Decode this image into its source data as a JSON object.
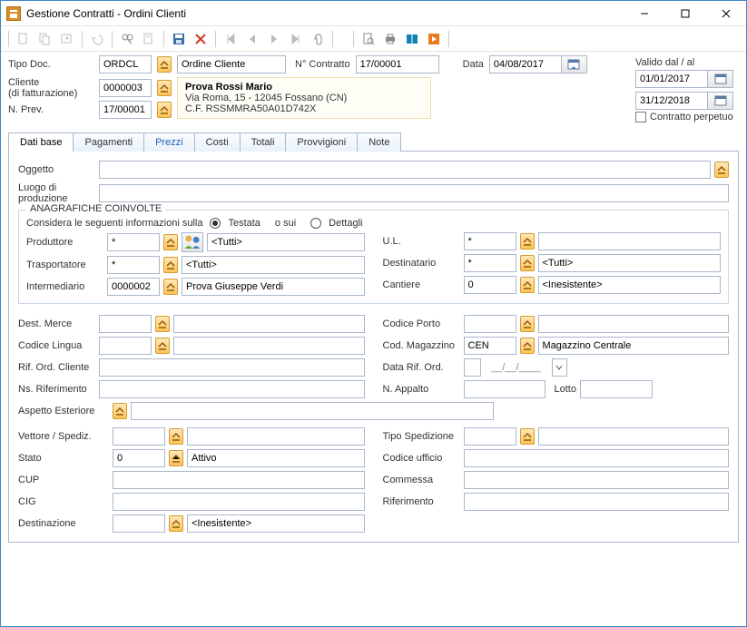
{
  "window": {
    "title": "Gestione Contratti - Ordini Clienti"
  },
  "header": {
    "tipo_doc_label": "Tipo Doc.",
    "tipo_doc_value": "ORDCL",
    "tipo_doc_desc": "Ordine Cliente",
    "n_contratto_label": "N° Contratto",
    "n_contratto_value": "17/00001",
    "data_label": "Data",
    "data_value": "04/08/2017",
    "cliente_label1": "Cliente",
    "cliente_label2": "(di fatturazione)",
    "cliente_value": "0000003",
    "nprev_label": "N. Prev.",
    "nprev_value": "17/00001",
    "addr_name": "Prova Rossi Mario",
    "addr_line1": "Via Roma, 15 - 12045 Fossano (CN)",
    "addr_line2": "C.F. RSSMMRA50A01D742X"
  },
  "validity": {
    "title": "Valido dal / al",
    "from": "01/01/2017",
    "to": "31/12/2018",
    "perpetuo_label": "Contratto perpetuo"
  },
  "tabs": {
    "t0": "Dati base",
    "t1": "Pagamenti",
    "t2": "Prezzi",
    "t3": "Costi",
    "t4": "Totali",
    "t5": "Provvigioni",
    "t6": "Note"
  },
  "base": {
    "oggetto_label": "Oggetto",
    "luogo_label1": "Luogo di",
    "luogo_label2": "produzione",
    "anag_title": "ANAGRAFICHE COINVOLTE",
    "considera_label": "Considera le seguenti informazioni sulla",
    "opt_testata": "Testata",
    "opt_osui": "o sui",
    "opt_dettagli": "Dettagli",
    "produttore_label": "Produttore",
    "produttore_value": "*",
    "produttore_desc": "<Tutti>",
    "ul_label": "U.L.",
    "ul_value": "*",
    "trasportatore_label": "Trasportatore",
    "trasportatore_value": "*",
    "trasportatore_desc": "<Tutti>",
    "destinatario_label": "Destinatario",
    "destinatario_value": "*",
    "destinatario_desc": "<Tutti>",
    "intermediario_label": "Intermediario",
    "intermediario_value": "0000002",
    "intermediario_desc": "Prova Giuseppe Verdi",
    "cantiere_label": "Cantiere",
    "cantiere_value": "0",
    "cantiere_desc": "<Inesistente>",
    "dest_merce_label": "Dest. Merce",
    "codice_porto_label": "Codice Porto",
    "codice_lingua_label": "Codice Lingua",
    "cod_magazzino_label": "Cod. Magazzino",
    "cod_magazzino_value": "CEN",
    "cod_magazzino_desc": "Magazzino Centrale",
    "rif_ord_cliente_label": "Rif. Ord. Cliente",
    "data_rif_ord_label": "Data Rif. Ord.",
    "data_rif_ord_value": "__/__/____",
    "ns_rif_label": "Ns. Riferimento",
    "n_appalto_label": "N. Appalto",
    "lotto_label": "Lotto",
    "aspetto_label": "Aspetto Esteriore",
    "vettore_label": "Vettore / Spediz.",
    "tipo_sped_label": "Tipo Spedizione",
    "stato_label": "Stato",
    "stato_value": "0",
    "stato_desc": "Attivo",
    "codice_uff_label": "Codice ufficio",
    "cup_label": "CUP",
    "commessa_label": "Commessa",
    "cig_label": "CIG",
    "riferimento_label": "Riferimento",
    "destinazione_label": "Destinazione",
    "destinazione_desc": "<Inesistente>"
  }
}
